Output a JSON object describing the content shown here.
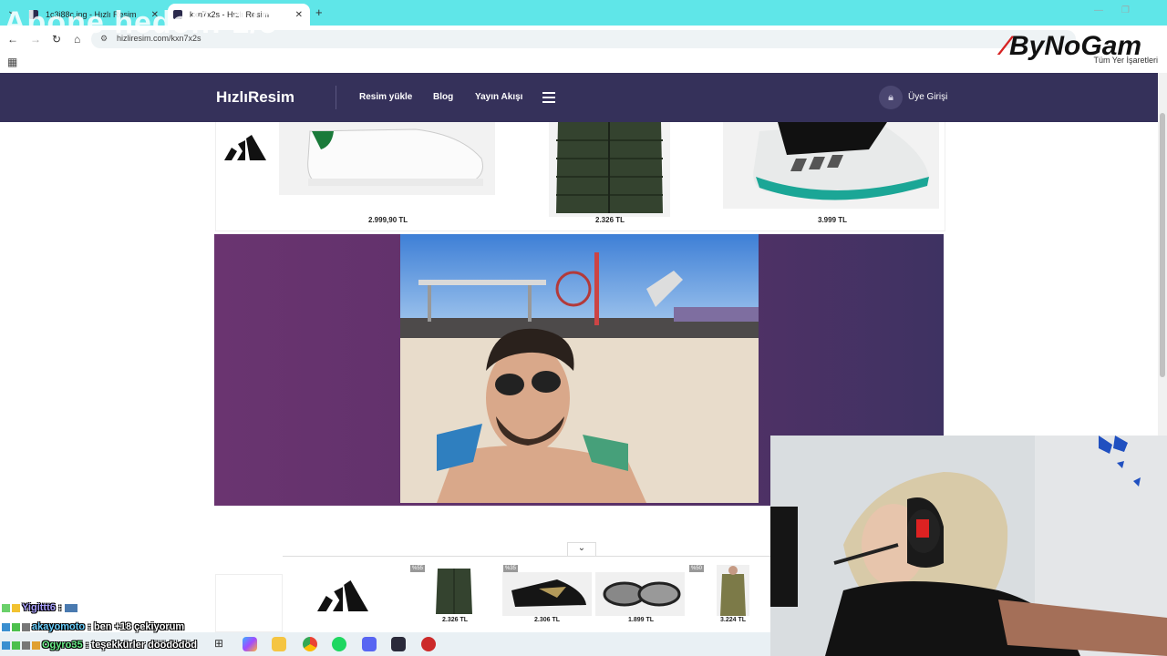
{
  "overlay": {
    "text": "Abone hedefi: 1/5"
  },
  "watermark": {
    "brand": "ByNoGam"
  },
  "browser": {
    "tabs": [
      {
        "title": "1c3j88c.jpg - Hızlı Resim",
        "active": false
      },
      {
        "title": "kxn7x2s - Hızlı Resim",
        "active": true
      }
    ],
    "url": "hizliresim.com/kxn7x2s",
    "bookmarks_all": "Tüm Yer İşaretleri"
  },
  "site": {
    "logo": "HızlıResim",
    "nav": [
      "Resim yükle",
      "Blog",
      "Yayın Akışı"
    ],
    "login": "Üye Girişi"
  },
  "top_ad": {
    "prices": [
      "2.999,90 TL",
      "2.326 TL",
      "3.999 TL"
    ]
  },
  "bottom_ad": {
    "badges": [
      "%55",
      "%35",
      "%50"
    ],
    "prices": [
      "2.326 TL",
      "2.306 TL",
      "1.899 TL",
      "3.224 TL"
    ]
  },
  "chat": [
    {
      "user": "Yigittt6",
      "sep": " : ",
      "msg": ""
    },
    {
      "user": "akayomoto",
      "sep": " : ",
      "msg": "ben +18 çekiyorum"
    },
    {
      "user": "Ogyro35",
      "sep": " : ",
      "msg": "teşekkürler döödödöd"
    }
  ],
  "colors": {
    "header_bg": "#35315a",
    "tab_bar": "#5fe6e8",
    "accent_purple": "#6a3470"
  }
}
